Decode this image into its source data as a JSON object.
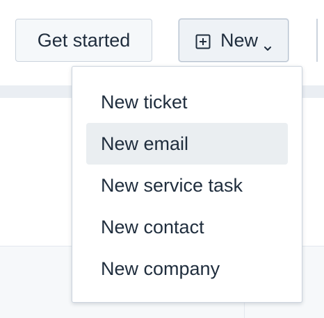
{
  "toolbar": {
    "get_started_label": "Get started",
    "new_label": "New",
    "new_icon": "plus-square-icon",
    "chevron_icon": "chevron-down-icon"
  },
  "menu": {
    "items": [
      {
        "label": "New ticket",
        "highlighted": false
      },
      {
        "label": "New email",
        "highlighted": true
      },
      {
        "label": "New service task",
        "highlighted": false
      },
      {
        "label": "New contact",
        "highlighted": false
      },
      {
        "label": "New company",
        "highlighted": false
      }
    ]
  },
  "colors": {
    "text": "#1f2d3d",
    "button_bg": "#f5f8fa",
    "border": "#cbd3dd",
    "highlight": "#eaeef1"
  }
}
